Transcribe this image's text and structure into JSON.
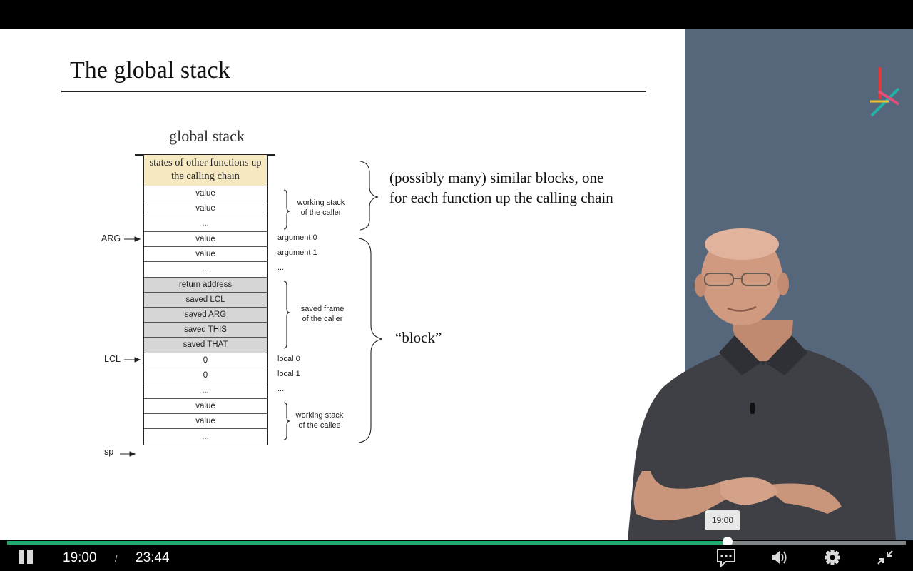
{
  "slide": {
    "title": "The global stack",
    "stack_heading": "global stack",
    "cells": [
      "states of other functions up the calling chain",
      "value",
      "value",
      "...",
      "value",
      "value",
      "...",
      "return address",
      "saved LCL",
      "saved ARG",
      "saved THIS",
      "saved THAT",
      "0",
      "0",
      "...",
      "value",
      "value",
      "..."
    ],
    "pointers": {
      "arg": "ARG",
      "lcl": "LCL",
      "sp": "sp"
    },
    "row_labels": [
      "argument 0",
      "argument 1",
      "...",
      "local 0",
      "local 1",
      "..."
    ],
    "brace_labels": {
      "working_caller": [
        "working stack",
        "of the caller"
      ],
      "saved_frame": [
        "saved frame",
        "of the caller"
      ],
      "working_callee": [
        "working stack",
        "of the callee"
      ]
    },
    "similar_blocks": [
      "(possibly many) similar blocks, one",
      "for each function up the calling chain"
    ],
    "block_label": "“block”"
  },
  "player": {
    "tooltip": "19:00",
    "current_time": "19:00",
    "separator": "/",
    "duration": "23:44",
    "progress_fraction": 0.803,
    "colors": {
      "played": "#1fa870",
      "unplayed": "#7e8687",
      "side_panel": "#56667b",
      "top_cell": "#f6e8c0",
      "frame_cell": "#d6d6d6"
    }
  }
}
